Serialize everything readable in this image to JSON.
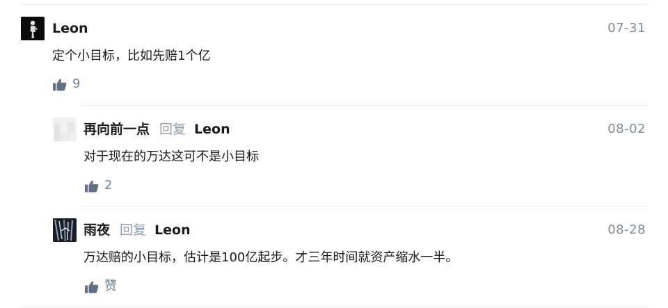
{
  "comment": {
    "author": "Leon",
    "date": "07-31",
    "text": "定个小目标，比如先赔1个亿",
    "likes": "9",
    "avatar_icon": "dark-figure-avatar"
  },
  "replies": [
    {
      "author": "再向前一点",
      "reply_label": "回复",
      "reply_to": "Leon",
      "date": "08-02",
      "text": "对于现在的万达这可不是小目标",
      "likes": "2",
      "avatar_icon": "light-gray-avatar"
    },
    {
      "author": "雨夜",
      "reply_label": "回复",
      "reply_to": "Leon",
      "date": "08-28",
      "text": "万达赔的小目标，估计是100亿起步。才三年时间就资产缩水一半。",
      "likes": "赞",
      "avatar_icon": "rainy-night-avatar"
    }
  ],
  "colors": {
    "accent_gray_blue": "#8c9bb0",
    "like_icon": "#5f7185",
    "divider": "#ececec"
  },
  "icons": {
    "like": "thumbs-up-icon"
  }
}
